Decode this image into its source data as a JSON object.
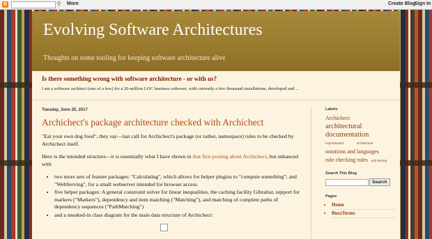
{
  "navbar": {
    "logo": "B",
    "more": "More",
    "create_blog": "Create Blog",
    "sign_in": "Sign In"
  },
  "header": {
    "title": "Evolving Software Architectures",
    "description": "Thoughts on some tooling for keeping software architecture alive"
  },
  "featured": {
    "title": "Is there something wrong with software architecture - or with us?",
    "snippet": "I am a software architect (one of a few) for a 20-million LOC business software, with currently a few thousand installations, developed and ..."
  },
  "post": {
    "date": "Tuesday, June 20, 2017",
    "title": "Archichect's package architecture checked with Archichect",
    "para1": "\"Eat your own dog food\", they say—last call for Archichect's package (or rather, namespace) rules to be checked by Archichect itself.",
    "para2_before": "Here is the intended structure—it is essentially what I have shown in ",
    "para2_link": "that first posting about Archichect",
    "para2_after": ", but enhanced with",
    "bullets": [
      "two more sets of feature packages: \"Calculating\", which allows for helper plugins to \"compute something\"; and \"WebServing\", for a small webserver intended for browser access.",
      "five helper packages: A general constraint solver for linear inequalities, the caching facility Gibraltar, support for markers (\"Markers\"), dependency and item matching (\"Matching\"), and matching of complete paths of dependency sequences (\"PathMatching\")",
      "and a sneaked-in class diagram for the main data structure of Archichect:"
    ]
  },
  "sidebar": {
    "labels_heading": "Labels",
    "labels": [
      {
        "text": "Archichect",
        "size": "m"
      },
      {
        "text": "architectural documentation",
        "size": "l"
      },
      {
        "text": "experimental",
        "size": "s"
      },
      {
        "text": "architecture",
        "size": "s"
      },
      {
        "text": "notations and languages",
        "size": "m"
      },
      {
        "text": "rule checking rules",
        "size": "m"
      },
      {
        "text": "unit testing",
        "size": "s"
      }
    ],
    "search_heading": "Search This Blog",
    "search_button": "Search",
    "pages_heading": "Pages",
    "pages": [
      "Home",
      "BuzzTerms"
    ]
  }
}
